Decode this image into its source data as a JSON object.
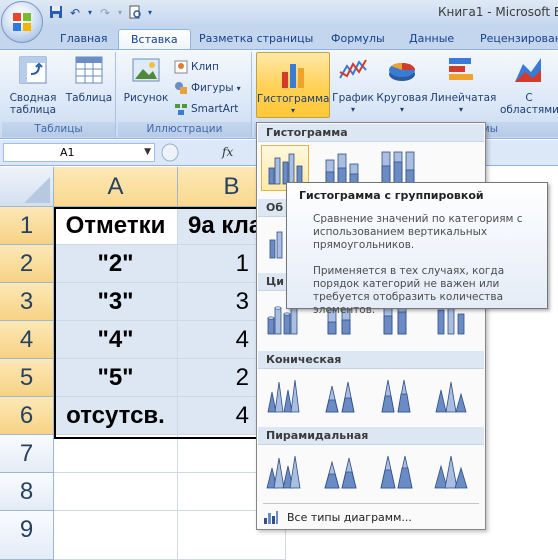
{
  "window": {
    "title": "Книга1 - Microsoft Ex"
  },
  "tabs": [
    "Главная",
    "Вставка",
    "Разметка страницы",
    "Формулы",
    "Данные",
    "Рецензирован"
  ],
  "ribbon": {
    "groups": {
      "tables": "Таблицы",
      "illustrations": "Иллюстрации",
      "charts": "мы"
    },
    "buttons": {
      "pivot_line1": "Сводная",
      "pivot_line2": "таблица",
      "table": "Таблица",
      "picture": "Рисунок",
      "clip": "Клип",
      "shapes": "Фигуры",
      "smartart": "SmartArt",
      "histogram": "Гистограмма",
      "graph": "График",
      "pie": "Круговая",
      "bar": "Линейчатая",
      "area_line1": "С",
      "area_line2": "областями"
    }
  },
  "formula_bar": {
    "name_box": "A1",
    "fx": "fx"
  },
  "sheet": {
    "columns": [
      "A",
      "B"
    ],
    "rows": [
      "1",
      "2",
      "3",
      "4",
      "5",
      "6",
      "7",
      "8",
      "9"
    ],
    "cells": [
      [
        "Отметки",
        "9а кла"
      ],
      [
        "\"2\"",
        "1"
      ],
      [
        "\"3\"",
        "3"
      ],
      [
        "\"4\"",
        "4"
      ],
      [
        "\"5\"",
        "2"
      ],
      [
        "отсутсв.",
        "4"
      ]
    ]
  },
  "gallery": {
    "sections": [
      "Гистограмма",
      "Об",
      "Ци",
      "Коническая",
      "Пирамидальная"
    ],
    "all_types": "Все типы диаграмм..."
  },
  "tooltip": {
    "title": "Гистограмма с группировкой",
    "body1": "Сравнение значений по категориям с использованием вертикальных прямоугольников.",
    "body2": "Применяется в тех случаях, когда порядок категорий не важен или требуется отобразить количества элементов."
  }
}
